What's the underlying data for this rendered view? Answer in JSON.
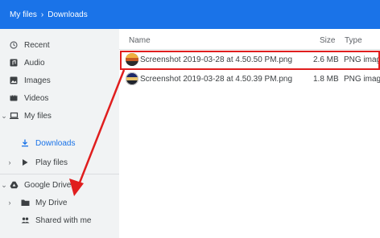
{
  "breadcrumb": {
    "root": "My files",
    "separator": "›",
    "current": "Downloads"
  },
  "sidebar": {
    "items": [
      {
        "label": "Recent",
        "icon": "clock-icon"
      },
      {
        "label": "Audio",
        "icon": "audio-icon"
      },
      {
        "label": "Images",
        "icon": "image-icon"
      },
      {
        "label": "Videos",
        "icon": "video-icon"
      },
      {
        "label": "My files",
        "icon": "laptop-icon",
        "expanded": true
      },
      {
        "label": "Downloads",
        "icon": "download-icon",
        "active": true
      },
      {
        "label": "Play files",
        "icon": "play-icon"
      },
      {
        "label": "Google Drive",
        "icon": "drive-icon",
        "expanded": true
      },
      {
        "label": "My Drive",
        "icon": "folder-icon"
      },
      {
        "label": "Shared with me",
        "icon": "people-icon"
      }
    ]
  },
  "columns": {
    "name": "Name",
    "size": "Size",
    "type": "Type"
  },
  "files": [
    {
      "name": "Screenshot 2019-03-28 at 4.50.50 PM.png",
      "size": "2.6 MB",
      "type": "PNG image",
      "selected": true
    },
    {
      "name": "Screenshot 2019-03-28 at 4.50.39 PM.png",
      "size": "1.8 MB",
      "type": "PNG image"
    }
  ],
  "colors": {
    "accent": "#1a73e8",
    "highlight": "#e01e1e",
    "sidebar_bg": "#f1f3f4"
  }
}
